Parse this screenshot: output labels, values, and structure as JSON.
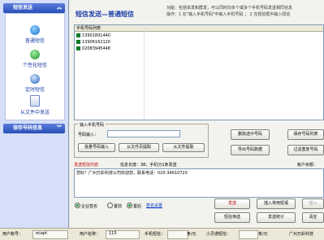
{
  "sidebar": {
    "section1_title": "短信发送",
    "items": [
      {
        "label": "普通短信",
        "icon": "sms-icon"
      },
      {
        "label": "个性化短信",
        "icon": "personalized-sms-icon"
      },
      {
        "label": "定时短信",
        "icon": "clock-icon"
      },
      {
        "label": "从文件中发送",
        "icon": "file-send-icon"
      }
    ],
    "section2_title": "保存号码信息"
  },
  "header": {
    "title": "短信发送—普通短信",
    "desc_line1": "功能：包括单发和群发，可以同时向多个或多个手机号码发送相同信息",
    "desc_line2": "操作：1 在\"输入手机号码\"中输入手机号码 ； 2 在短信框中输入短信"
  },
  "grid": {
    "header": "手机号码列表",
    "rows": [
      "13901891440",
      "13906162120",
      "02083945448"
    ]
  },
  "input_group": {
    "title": "输入手机号码",
    "number_label": "号码输入：",
    "number_value": "",
    "buttons": [
      "批量号码输入",
      "从文件页提取",
      "从文件提取"
    ]
  },
  "right_buttons": [
    "删除选中号码",
    "保存号码列表",
    "导出号码数据",
    "过滤重复号码"
  ],
  "message": {
    "title": "发送短信内容",
    "info": "信息长度：38；手机分1条发送",
    "account_label": "帐户余额：",
    "content": "您好！广州万彩科技公司欢迎您，联系电话：020-34610720"
  },
  "options": {
    "sign_label": "企业签名",
    "sign_checked": true,
    "radio1": "置前",
    "radio2": "置后",
    "link": "签名设置"
  },
  "actions": {
    "send": "发送",
    "common_phrases": "插入常用短语",
    "sms_template": "插入",
    "sms_screen": "短信筛选",
    "send_stats": "发送统计",
    "clear": "清空"
  },
  "statusbar": {
    "user_label": "用户帐号：",
    "user_value": "ecapt",
    "name_label": "用户名称：",
    "name_value": "115",
    "phone_label": "手机短信：",
    "phone_value": "",
    "unit_label": "条/元",
    "small_label": "小灵通短信：",
    "small_value": "",
    "unit2_label": "条/元",
    "version": "广州万彩科技"
  }
}
